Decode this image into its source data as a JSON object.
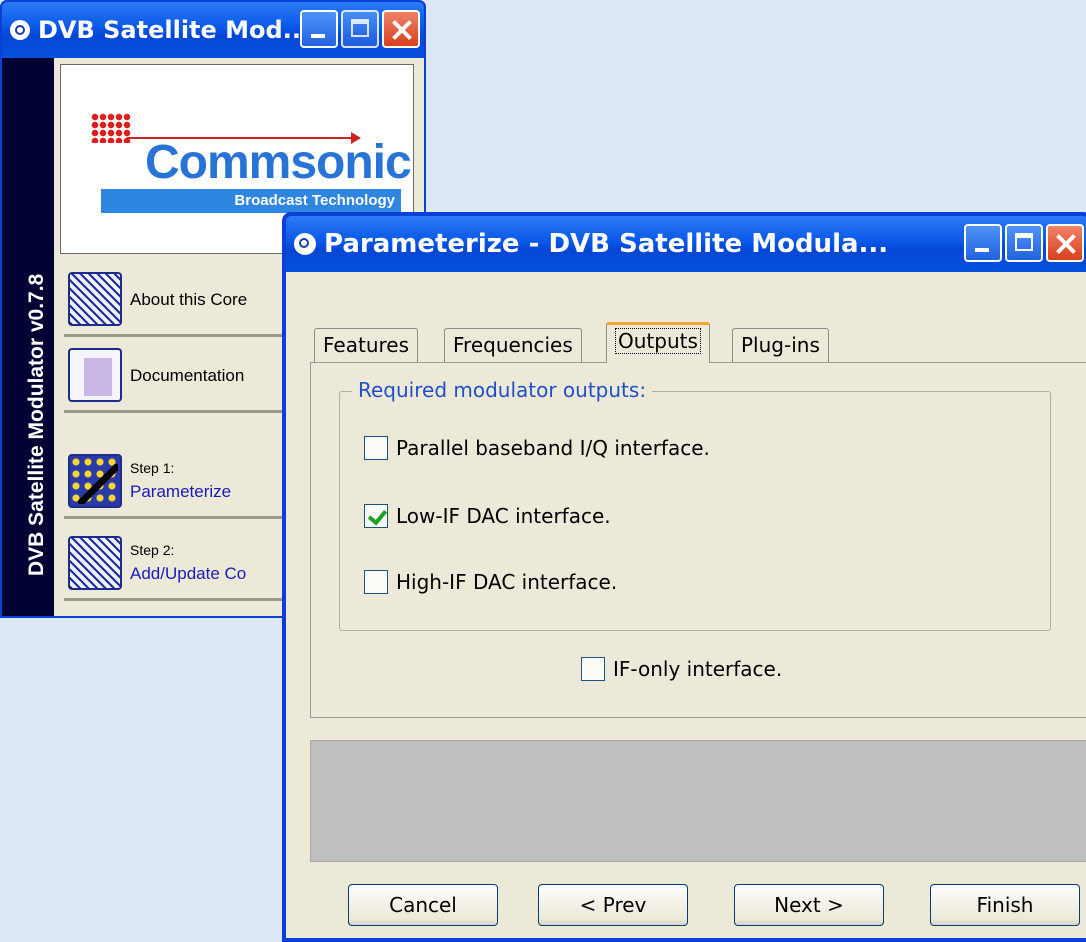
{
  "back_window": {
    "title": "DVB Satellite Mod...",
    "sidebar_text": "DVB Satellite Modulator v0.7.8",
    "logo": {
      "name": "Commsonic",
      "tagline": "Broadcast Technology"
    },
    "items": [
      {
        "label": "About this Core",
        "icon": "cube-icon"
      },
      {
        "label": "Documentation",
        "icon": "document-icon"
      },
      {
        "step": "Step 1:",
        "label": "Parameterize",
        "icon": "wand-icon"
      },
      {
        "step": "Step 2:",
        "label": "Add/Update Co",
        "icon": "cube-icon"
      }
    ]
  },
  "front_window": {
    "title": "Parameterize - DVB Satellite Modula...",
    "tabs": [
      "Features",
      "Frequencies",
      "Outputs",
      "Plug-ins"
    ],
    "active_tab": "Outputs",
    "group_label": "Required modulator outputs:",
    "options": [
      {
        "label": "Parallel baseband I/Q interface.",
        "checked": false
      },
      {
        "label": "Low-IF DAC interface.",
        "checked": true
      },
      {
        "label": "High-IF DAC interface.",
        "checked": false
      }
    ],
    "if_only": {
      "label": "IF-only interface.",
      "checked": false
    },
    "buttons": {
      "cancel": "Cancel",
      "prev": "< Prev",
      "next": "Next >",
      "finish": "Finish"
    }
  },
  "colors": {
    "titlebar": "#0a58e8",
    "sidebar": "#000033",
    "window_bg": "#ece9d8",
    "desktop": "#dde8f7",
    "checkmark": "#21a121"
  }
}
